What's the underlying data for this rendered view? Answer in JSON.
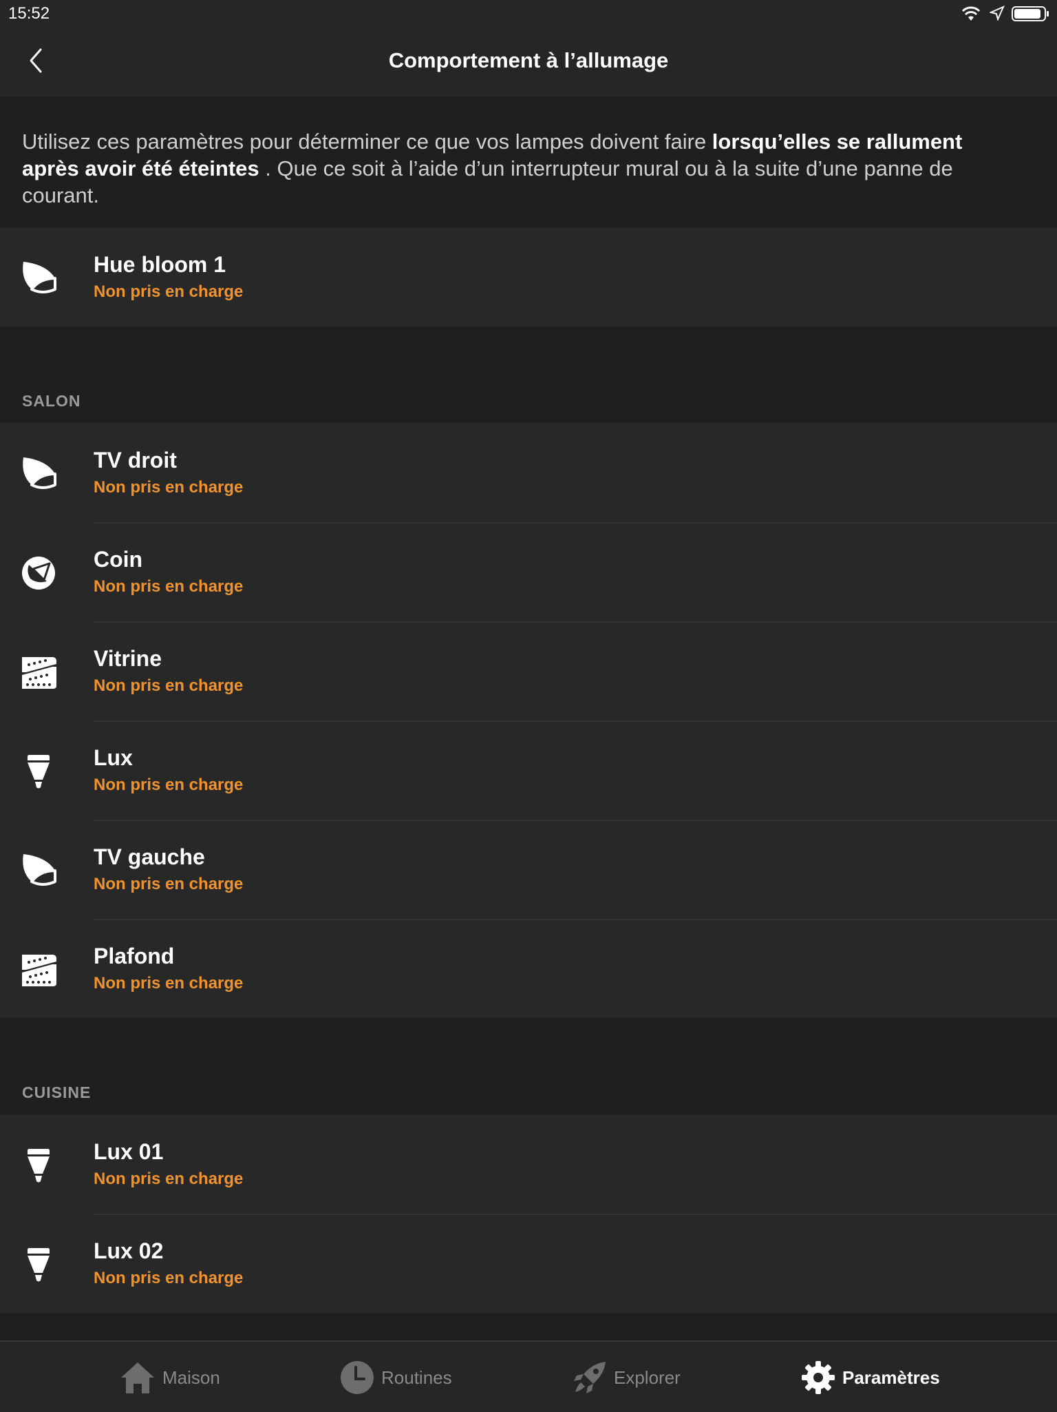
{
  "status_bar": {
    "time": "15:52"
  },
  "header": {
    "title": "Comportement à l’allumage"
  },
  "intro": {
    "text_before": "Utilisez ces paramètres pour déterminer ce que vos lampes doivent faire ",
    "text_bold": "lorsqu’elles se rallument après avoir été éteintes",
    "text_after": " . Que ce soit à l’aide d’un interrupteur mural ou à la suite d’une panne de courant."
  },
  "ungrouped": {
    "items": [
      {
        "name": "Hue bloom 1",
        "status": "Non pris en charge",
        "icon": "bloom-lamp-icon"
      }
    ]
  },
  "sections": [
    {
      "title": "SALON",
      "items": [
        {
          "name": "TV droit",
          "status": "Non pris en charge",
          "icon": "bloom-lamp-icon"
        },
        {
          "name": "Coin",
          "status": "Non pris en charge",
          "icon": "iris-lamp-icon"
        },
        {
          "name": "Vitrine",
          "status": "Non pris en charge",
          "icon": "lightstrip-icon"
        },
        {
          "name": "Lux",
          "status": "Non pris en charge",
          "icon": "bulb-icon"
        },
        {
          "name": "TV gauche",
          "status": "Non pris en charge",
          "icon": "bloom-lamp-icon"
        },
        {
          "name": "Plafond",
          "status": "Non pris en charge",
          "icon": "lightstrip-icon"
        }
      ]
    },
    {
      "title": "CUISINE",
      "items": [
        {
          "name": "Lux 01",
          "status": "Non pris en charge",
          "icon": "bulb-icon"
        },
        {
          "name": "Lux 02",
          "status": "Non pris en charge",
          "icon": "bulb-icon"
        }
      ]
    }
  ],
  "tabs": [
    {
      "label": "Maison",
      "icon": "home-icon",
      "active": false
    },
    {
      "label": "Routines",
      "icon": "clock-icon",
      "active": false
    },
    {
      "label": "Explorer",
      "icon": "rocket-icon",
      "active": false
    },
    {
      "label": "Paramètres",
      "icon": "gear-icon",
      "active": true
    }
  ],
  "colors": {
    "background": "#1f1f1f",
    "panel": "#282828",
    "accent_status": "#f0932f",
    "section_header": "#9a9a9a"
  }
}
